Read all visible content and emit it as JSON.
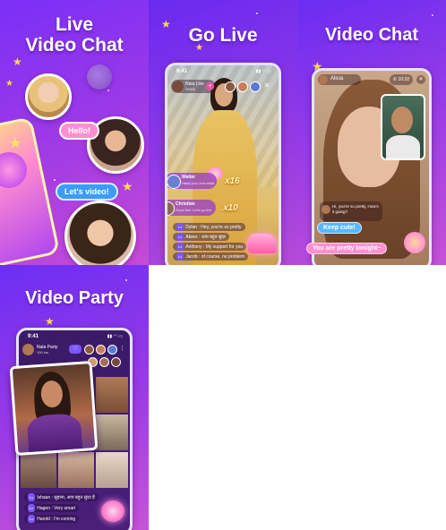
{
  "panels": {
    "live_video_chat": {
      "title_line1": "Live",
      "title_line2": "Video Chat",
      "bubble_hello": "Hello!",
      "bubble_lets_video": "Let's video!"
    },
    "go_live": {
      "title": "Go Live",
      "status_time": "9:41",
      "host_name": "Nala Live",
      "host_sub": "20000",
      "gift_count_1": "x16",
      "gift_count_2": "x10",
      "comments": [
        {
          "name": "Walter",
          "text": "Have you Love what"
        },
        {
          "name": "Christian",
          "text": "Good live. Let's go live"
        }
      ],
      "chat_lines": [
        {
          "tag": "Lv",
          "text": "Dylan : Hey, you're so pretty"
        },
        {
          "tag": "Lv",
          "text": "Abeer : आप बहुत सुंदर"
        },
        {
          "tag": "Lv",
          "text": "Anthony : My support for you"
        },
        {
          "tag": "Lv",
          "text": "Jacob : of course, no problem"
        }
      ]
    },
    "video_chat": {
      "title": "Video Chat",
      "caller_name": "Alicia",
      "call_timer": "10:32",
      "message_text": "Hi, you're so pretty, How's it going?",
      "bubble_keep_cute": "Keep cute!",
      "bubble_pretty": "You are pretty tonight~"
    },
    "video_party": {
      "title": "Video Party",
      "status_time": "9:41",
      "room_name": "Nala Party",
      "room_sub": "100 ios",
      "chat_lines": [
        {
          "tag": "Lv",
          "text": "Ishaan : सुहाना, आप बहुत सुंदर हैं"
        },
        {
          "tag": "Lv",
          "text": "Hagen : Very smart"
        },
        {
          "tag": "Lv",
          "text": "Harold : I'm coming"
        }
      ]
    }
  },
  "colors": {
    "purple_dark": "#6a2af0",
    "purple_mid": "#9a38e8",
    "pink": "#ff6fb5",
    "bubble_pink": "#ff8fd0",
    "bubble_blue": "#58b8ff",
    "star_yellow": "#ffd84a"
  }
}
